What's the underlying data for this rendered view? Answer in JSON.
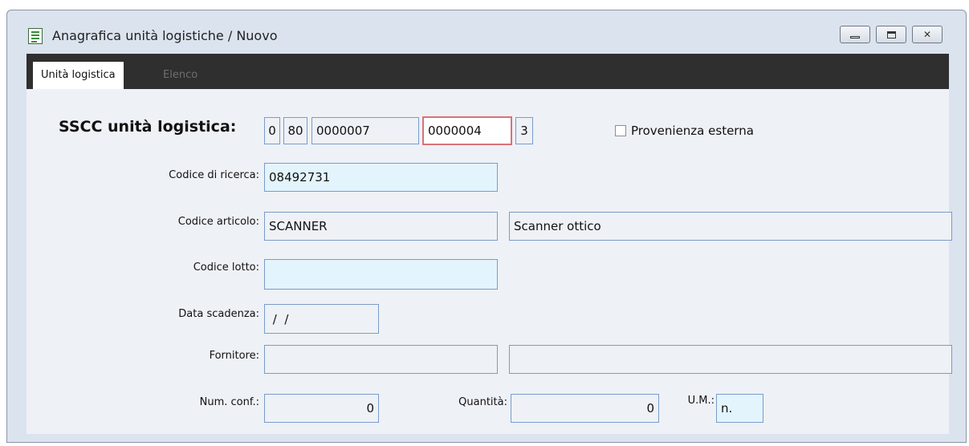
{
  "window": {
    "title": "Anagrafica unità logistiche / Nuovo",
    "icons": {
      "minimize": "minimize-icon",
      "maximize": "maximize-icon",
      "close": "close-icon"
    }
  },
  "tabs": [
    {
      "label": "Unità logistica",
      "active": true
    },
    {
      "label": "Elenco",
      "active": false
    }
  ],
  "form": {
    "sscc": {
      "label": "SSCC unità logistica:",
      "parts": [
        "0",
        "80",
        "0000007",
        "0000004",
        "3"
      ]
    },
    "provenienza_esterna": {
      "label": "Provenienza esterna",
      "checked": false
    },
    "codice_ricerca": {
      "label": "Codice di ricerca:",
      "value": "08492731"
    },
    "codice_articolo": {
      "label": "Codice articolo:",
      "value": "SCANNER",
      "description": "Scanner ottico"
    },
    "codice_lotto": {
      "label": "Codice lotto:",
      "value": ""
    },
    "data_scadenza": {
      "label": "Data scadenza:",
      "value": " /  /"
    },
    "fornitore": {
      "label": "Fornitore:",
      "value": "",
      "description": ""
    },
    "num_conf": {
      "label": "Num. conf.:",
      "value": "0"
    },
    "quantita": {
      "label": "Quantità:",
      "value": "0"
    },
    "um": {
      "label": "U.M.:",
      "value": "n."
    }
  },
  "colors": {
    "panel": "#eef1f6",
    "editable_field": "#e3f4fd",
    "field_border": "#7a9cc8",
    "focus_border": "#d9727b",
    "tabbar": "#2f2f2f"
  }
}
